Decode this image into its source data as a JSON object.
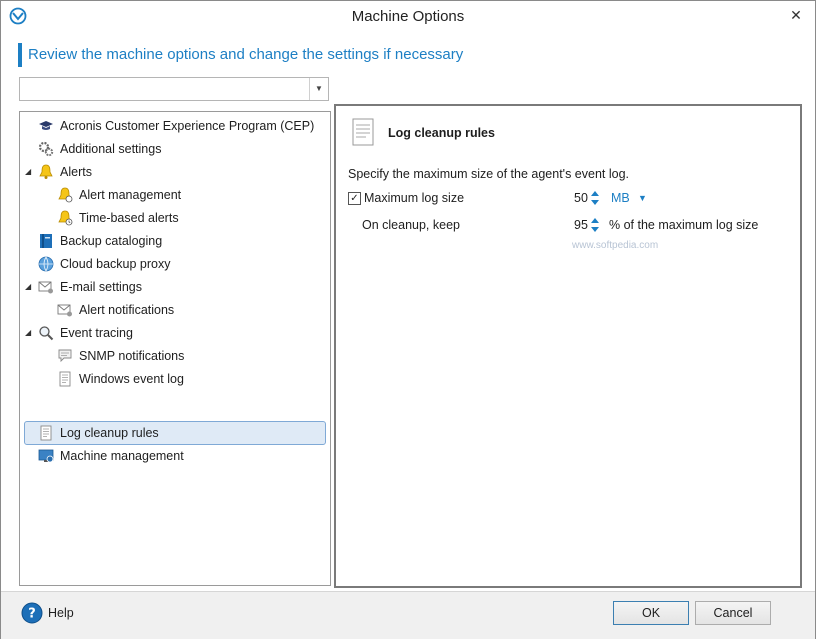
{
  "window": {
    "title": "Machine Options",
    "close_glyph": "✕"
  },
  "header": {
    "text": "Review the machine options and change the settings if necessary"
  },
  "search": {
    "value": "",
    "dropdown_glyph": "▼"
  },
  "tree": {
    "items": [
      {
        "label": "Acronis Customer Experience Program (CEP)",
        "icon": "graduation-cap-icon"
      },
      {
        "label": "Additional settings",
        "icon": "gears-icon"
      },
      {
        "label": "Alerts",
        "icon": "bell-icon",
        "expander": "◢"
      },
      {
        "label": "Alert management",
        "icon": "bell-warning-icon"
      },
      {
        "label": "Time-based alerts",
        "icon": "bell-clock-icon"
      },
      {
        "label": "Backup cataloging",
        "icon": "catalog-book-icon"
      },
      {
        "label": "Cloud backup proxy",
        "icon": "globe-icon"
      },
      {
        "label": "E-mail settings",
        "icon": "email-gear-icon",
        "expander": "◢"
      },
      {
        "label": "Alert notifications",
        "icon": "email-alert-icon"
      },
      {
        "label": "Event tracing",
        "icon": "magnifier-icon",
        "expander": "◢"
      },
      {
        "label": "SNMP notifications",
        "icon": "speech-bubble-icon"
      },
      {
        "label": "Windows event log",
        "icon": "log-page-icon"
      },
      {
        "label": "Log cleanup rules",
        "icon": "log-cleanup-icon",
        "selected": true
      },
      {
        "label": "Machine management",
        "icon": "monitor-icon"
      }
    ]
  },
  "pane": {
    "title": "Log cleanup rules",
    "description": "Specify the maximum size of the agent's event log.",
    "max_log": {
      "label": "Maximum log size",
      "checked": true,
      "value": "50",
      "unit": "MB"
    },
    "cleanup": {
      "label": "On cleanup, keep",
      "value": "95",
      "suffix": "% of the maximum log size"
    }
  },
  "watermark": "www.softpedia.com",
  "footer": {
    "help_label": "Help",
    "ok_label": "OK",
    "cancel_label": "Cancel"
  },
  "colors": {
    "accent": "#1d7fc4",
    "selection": "#dfeaf6"
  }
}
